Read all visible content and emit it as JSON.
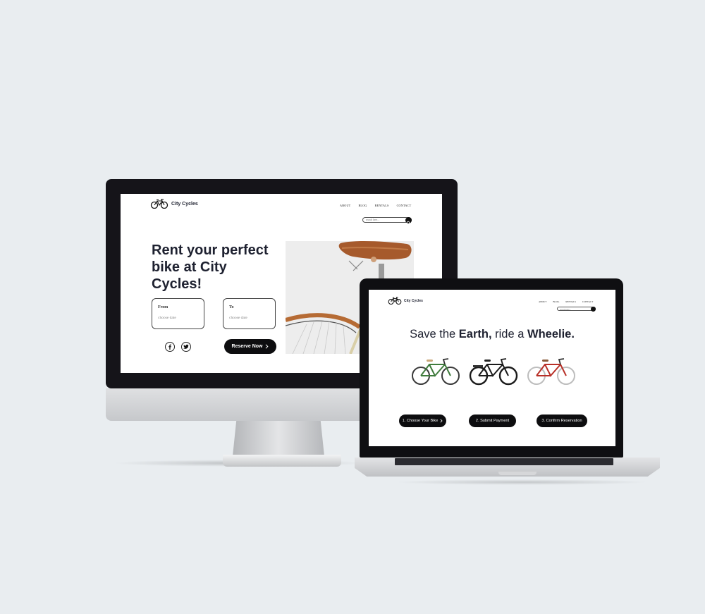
{
  "desktop": {
    "brand": "City Cycles",
    "nav": [
      "ABOUT",
      "BLOG",
      "RENTALS",
      "CONTACT"
    ],
    "search_placeholder": "search here...",
    "hero_title": "Rent your perfect bike at City Cycles!",
    "from_label": "From",
    "from_placeholder": "choose date",
    "to_label": "To",
    "to_placeholder": "choose date",
    "reserve_label": "Reserve Now",
    "social_icons": [
      "facebook-icon",
      "twitter-icon"
    ]
  },
  "laptop": {
    "brand": "City Cycles",
    "nav": [
      "ABOUT",
      "BLOG",
      "RENTALS",
      "CONTACT"
    ],
    "search_placeholder": "search here...",
    "tagline": {
      "part1": "Save the ",
      "bold1": "Earth,",
      "part2": " ride a ",
      "bold2": "Wheelie."
    },
    "bikes": [
      {
        "color": "#3f7b3c"
      },
      {
        "color": "#1b1b1b"
      },
      {
        "color": "#b83028"
      }
    ],
    "steps": [
      "1. Choose Your Bike",
      "2. Submit Payment",
      "3. Confirm Reservation"
    ]
  },
  "colors": {
    "background": "#e9edf0",
    "text_dark": "#1e2130",
    "button": "#0d0d0f",
    "saddle": "#a65a2c"
  }
}
